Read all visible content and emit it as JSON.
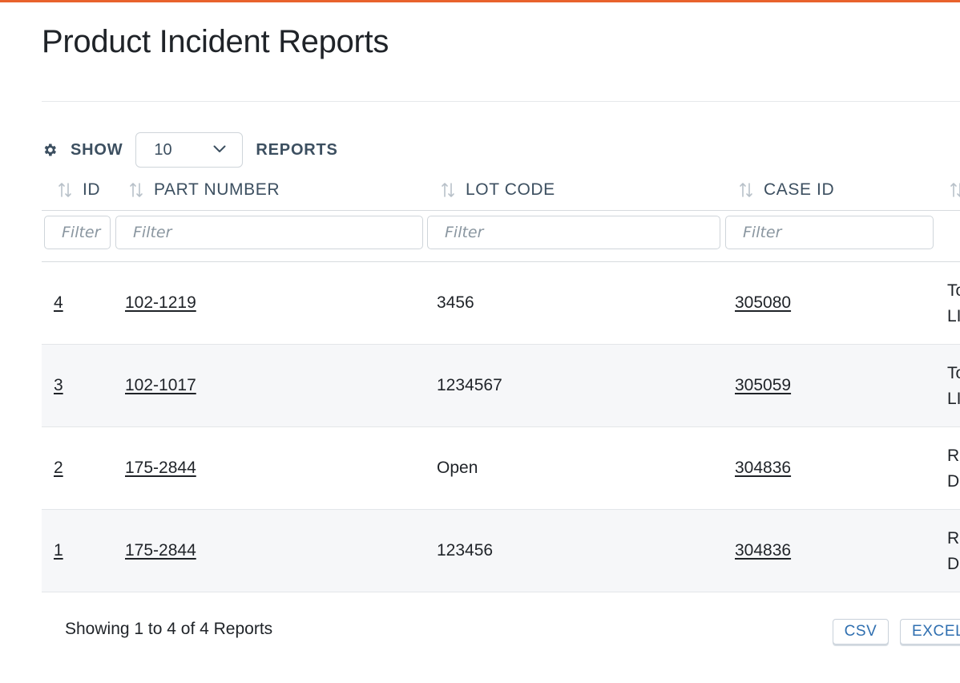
{
  "page": {
    "title": "Product Incident Reports",
    "accent_color": "#e8622c"
  },
  "length_menu": {
    "icon": "gear-icon",
    "prefix": "SHOW",
    "selected": "10",
    "suffix": "REPORTS"
  },
  "columns": [
    {
      "label": "ID",
      "filter_placeholder": "Filter"
    },
    {
      "label": "PART NUMBER",
      "filter_placeholder": "Filter"
    },
    {
      "label": "LOT CODE",
      "filter_placeholder": "Filter"
    },
    {
      "label": "CASE ID",
      "filter_placeholder": "Filter"
    }
  ],
  "rows": [
    {
      "id": "4",
      "part_number": "102-1219",
      "lot_code": "3456",
      "case_id": "305080",
      "next_col_line1": "To",
      "next_col_line2": "LI"
    },
    {
      "id": "3",
      "part_number": "102-1017",
      "lot_code": "1234567",
      "case_id": "305059",
      "next_col_line1": "To",
      "next_col_line2": "LI"
    },
    {
      "id": "2",
      "part_number": "175-2844",
      "lot_code": "Open",
      "case_id": "304836",
      "next_col_line1": "R",
      "next_col_line2": "D"
    },
    {
      "id": "1",
      "part_number": "175-2844",
      "lot_code": "123456",
      "case_id": "304836",
      "next_col_line1": "R",
      "next_col_line2": "D"
    }
  ],
  "footer": {
    "info": "Showing 1 to 4 of 4 Reports",
    "csv_label": "CSV",
    "excel_label": "EXCEL"
  },
  "colors": {
    "header_text": "#3c4f60",
    "button_text": "#2f6fb0",
    "row_alt_bg": "#f6f7f9"
  }
}
